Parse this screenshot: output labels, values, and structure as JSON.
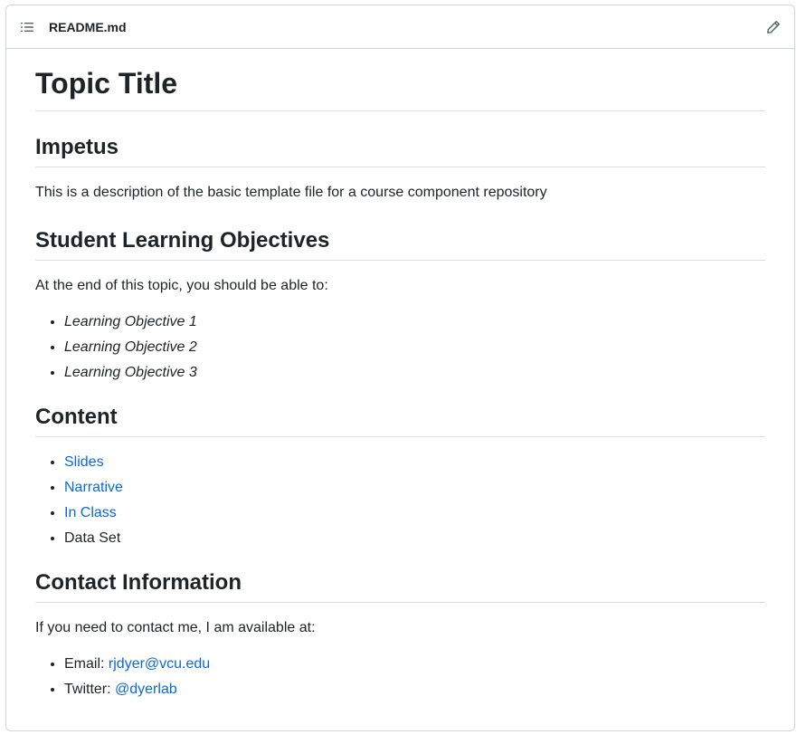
{
  "header": {
    "toc_icon": "list-unordered-icon",
    "file_name": "README.md",
    "edit_icon": "pencil-icon"
  },
  "readme": {
    "title": "Topic Title",
    "impetus": {
      "heading": "Impetus",
      "text": "This is a description of the basic template file for a course component repository"
    },
    "objectives": {
      "heading": "Student Learning Objectives",
      "intro": "At the end of this topic, you should be able to:",
      "items": [
        "Learning Objective 1",
        "Learning Objective 2",
        "Learning Objective 3"
      ]
    },
    "content": {
      "heading": "Content",
      "links": [
        "Slides",
        "Narrative",
        "In Class"
      ],
      "plain_item": "Data Set"
    },
    "contact": {
      "heading": "Contact Information",
      "intro": "If you need to contact me, I am available at:",
      "email_label": "Email: ",
      "email": "rjdyer@vcu.edu",
      "twitter_label": "Twitter: ",
      "twitter": "@dyerlab"
    }
  },
  "colors": {
    "link": "#0969da",
    "text": "#1f2328",
    "border": "#d0d7de"
  }
}
